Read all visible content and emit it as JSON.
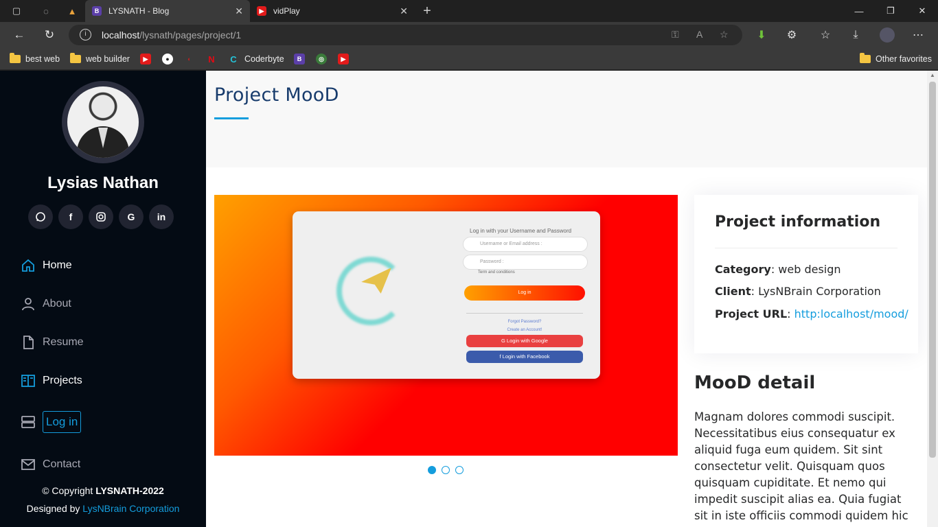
{
  "browser": {
    "tabs": [
      {
        "title": "LYSNATH - Blog",
        "active": true,
        "fav": "B",
        "fav_color": "#5b3fa8"
      },
      {
        "title": "vidPlay",
        "active": false,
        "fav": "▶",
        "fav_color": "#e21b1b"
      }
    ],
    "url_host": "localhost",
    "url_path": "/lysnath/pages/project/1",
    "bookmarks": [
      {
        "label": "best web",
        "type": "folder"
      },
      {
        "label": "web builder",
        "type": "folder"
      },
      {
        "label": "Coderbyte",
        "type": "site"
      }
    ],
    "other_favorites": "Other favorites"
  },
  "sidebar": {
    "name": "Lysias Nathan",
    "socials": [
      "whatsapp-icon",
      "facebook-icon",
      "instagram-icon",
      "google-icon",
      "linkedin-icon"
    ],
    "menu": [
      {
        "label": "Home",
        "icon": "home-icon",
        "active": true
      },
      {
        "label": "About",
        "icon": "user-icon",
        "active": false
      },
      {
        "label": "Resume",
        "icon": "file-icon",
        "active": false
      },
      {
        "label": "Projects",
        "icon": "projects-icon",
        "active": true
      },
      {
        "label": "Log in",
        "icon": "server-icon",
        "active": false
      },
      {
        "label": "Contact",
        "icon": "envelope-icon",
        "active": false
      }
    ],
    "copyright_prefix": "© Copyright ",
    "copyright_brand": "LYSNATH-2022",
    "designed_prefix": "Designed by ",
    "designed_link": "LysNBrain Corporation"
  },
  "main": {
    "page_title": "Project MooD",
    "slider": {
      "mock_heading": "Log in with your Username and Password",
      "mock_username": "Username or Email address :",
      "mock_password": "Password :",
      "mock_terms": "Term and conditions",
      "mock_login": "Log in",
      "mock_forgot": "Forgot Password?",
      "mock_create": "Create an Account!",
      "mock_google": "G  Login with Google",
      "mock_facebook": "f  Login with Facebook",
      "slide_count": 3,
      "active_slide": 1
    },
    "info": {
      "title": "Project information",
      "category_label": "Category",
      "category_value": "web design",
      "client_label": "Client",
      "client_value": "LysNBrain Corporation",
      "url_label": "Project URL",
      "url_value": "http:localhost/mood/"
    },
    "detail_title": "MooD detail",
    "detail_text": "Magnam dolores commodi suscipit. Necessitatibus eius consequatur ex aliquid fuga eum quidem. Sit sint consectetur velit. Quisquam quos quisquam cupiditate. Et nemo qui impedit suscipit alias ea. Quia fugiat sit in iste officiis commodi quidem hic"
  },
  "colors": {
    "accent": "#149ddd",
    "sidebar_bg": "#040b14",
    "title": "#173b6c"
  }
}
